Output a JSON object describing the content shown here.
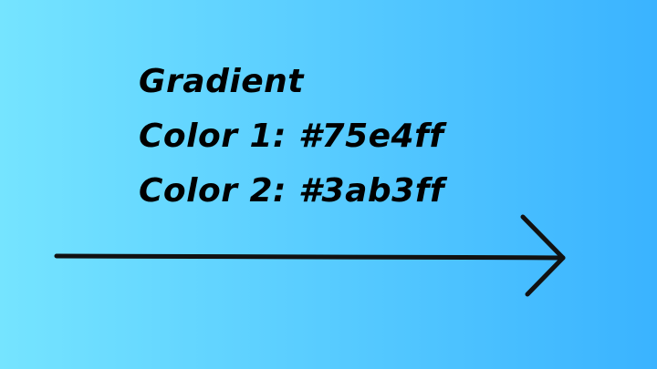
{
  "colors": {
    "gradient_start": "#75e4ff",
    "gradient_end": "#3ab3ff",
    "text": "#000000",
    "arrow": "#111111"
  },
  "slide": {
    "title": "Gradient",
    "color1_line": "Color 1: #75e4ff",
    "color2_line": "Color 2: #3ab3ff"
  },
  "arrow": {
    "direction": "right",
    "icon": "arrow-right-icon"
  }
}
